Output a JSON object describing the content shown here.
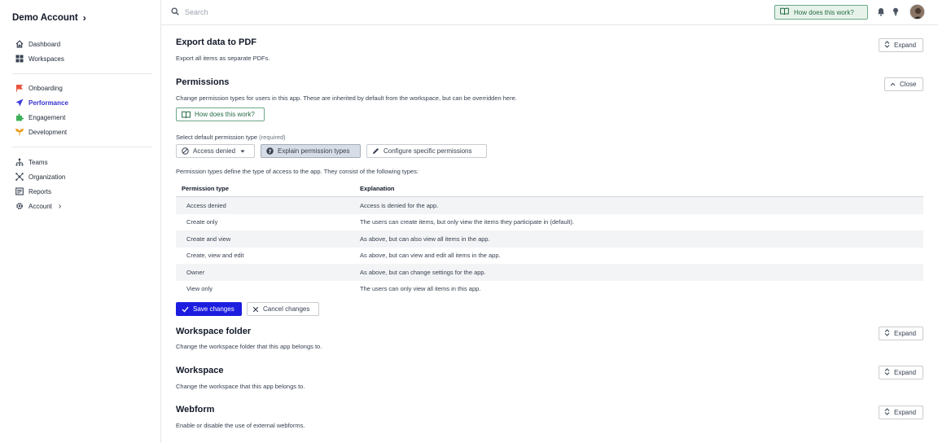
{
  "sidebar": {
    "account_name": "Demo Account",
    "group1": [
      {
        "label": "Dashboard",
        "icon": "home-icon"
      },
      {
        "label": "Workspaces",
        "icon": "grid-icon"
      }
    ],
    "group2": [
      {
        "label": "Onboarding",
        "icon": "flag-icon",
        "color": "#e8543f"
      },
      {
        "label": "Performance",
        "icon": "send-icon",
        "color": "#3a3ae0"
      },
      {
        "label": "Engagement",
        "icon": "puzzle-icon",
        "color": "#3fb05a"
      },
      {
        "label": "Development",
        "icon": "sprout-icon",
        "color": "#e8a020"
      }
    ],
    "group3": [
      {
        "label": "Teams",
        "icon": "teams-icon"
      },
      {
        "label": "Organization",
        "icon": "org-icon"
      },
      {
        "label": "Reports",
        "icon": "reports-icon"
      },
      {
        "label": "Account",
        "icon": "gear-icon"
      }
    ],
    "active": "Performance"
  },
  "header": {
    "search_placeholder": "Search",
    "help_button": "How does this work?"
  },
  "sections": {
    "export": {
      "title": "Export data to PDF",
      "desc": "Export all items as separate PDFs.",
      "button": "Expand"
    },
    "permissions": {
      "title": "Permissions",
      "desc": "Change permission types for users in this app. These are inherited by default from the workspace, but can be overridden here.",
      "close_button": "Close",
      "help_button": "How does this work?",
      "select_label": "Select default permission type",
      "select_required": "(required)",
      "selected_value": "Access denied",
      "explain_button": "Explain permission types",
      "configure_button": "Configure specific permissions",
      "table_intro": "Permission types define the type of access to the app. They consist of the following types:",
      "columns": [
        "Permission type",
        "Explanation"
      ],
      "rows": [
        [
          "Access denied",
          "Access is denied for the app."
        ],
        [
          "Create only",
          "The users can create items, but only view the items they participate in (default)."
        ],
        [
          "Create and view",
          "As above, but can also view all items in the app."
        ],
        [
          "Create, view and edit",
          "As above, but can view and edit all items in the app."
        ],
        [
          "Owner",
          "As above, but can change settings for the app."
        ],
        [
          "View only",
          "The users can only view all items in this app."
        ]
      ],
      "save_button": "Save changes",
      "cancel_button": "Cancel changes"
    },
    "folder": {
      "title": "Workspace folder",
      "desc": "Change the workspace folder that this app belongs to.",
      "button": "Expand"
    },
    "workspace": {
      "title": "Workspace",
      "desc": "Change the workspace that this app belongs to.",
      "button": "Expand"
    },
    "webform": {
      "title": "Webform",
      "desc": "Enable or disable the use of external webforms.",
      "button": "Expand"
    }
  }
}
